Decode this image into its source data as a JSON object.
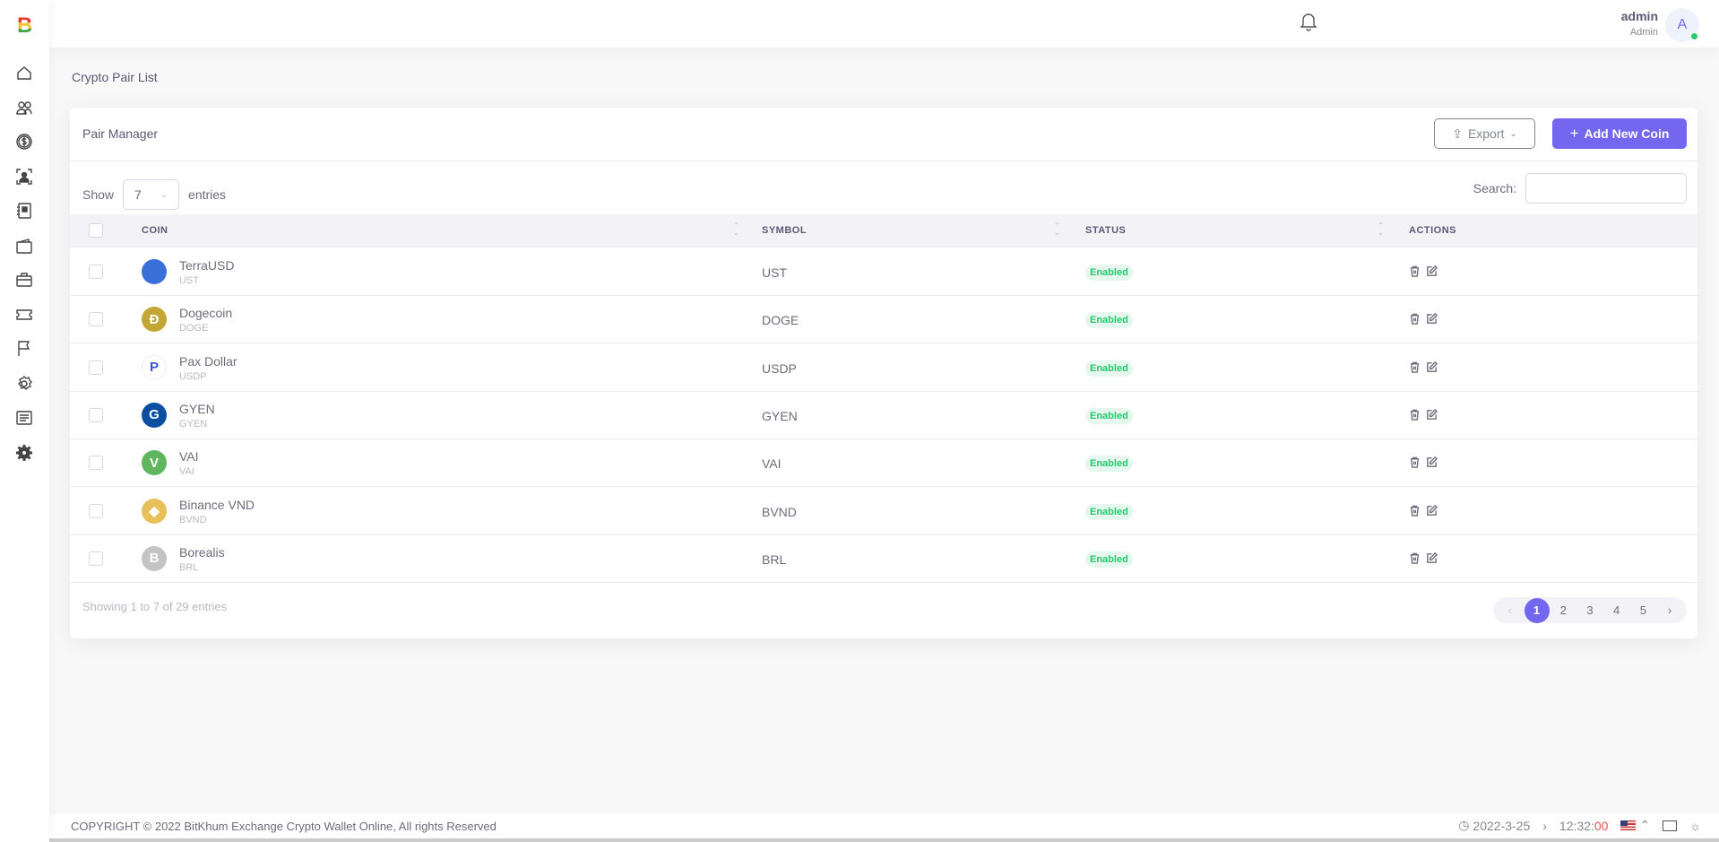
{
  "brand": {
    "logo_letter": "B"
  },
  "sidebar": {
    "items": [
      {
        "icon": "home-icon"
      },
      {
        "icon": "users-icon"
      },
      {
        "icon": "dollar-icon"
      },
      {
        "icon": "user-scan-icon"
      },
      {
        "icon": "document-icon"
      },
      {
        "icon": "wallet-icon"
      },
      {
        "icon": "briefcase-icon"
      },
      {
        "icon": "ticket-icon"
      },
      {
        "icon": "flag-icon"
      },
      {
        "icon": "settings-icon"
      },
      {
        "icon": "list-icon"
      },
      {
        "icon": "gear-filled-icon"
      }
    ]
  },
  "header": {
    "user_name": "admin",
    "user_role": "Admin",
    "avatar_letter": "A"
  },
  "breadcrumb": "Crypto Pair List",
  "card": {
    "title": "Pair Manager",
    "export_label": "Export",
    "add_label": "Add New Coin"
  },
  "table_controls": {
    "show_label": "Show",
    "entries_value": "7",
    "entries_label": "entries",
    "search_label": "Search:",
    "search_value": ""
  },
  "columns": [
    "COIN",
    "SYMBOL",
    "STATUS",
    "ACTIONS"
  ],
  "rows": [
    {
      "name": "TerraUSD",
      "sub": "UST",
      "symbol": "UST",
      "status": "Enabled",
      "icon_color": "#3a6fd8",
      "glyph": ""
    },
    {
      "name": "Dogecoin",
      "sub": "DOGE",
      "symbol": "DOGE",
      "status": "Enabled",
      "icon_color": "#c3a634",
      "glyph": "Ð"
    },
    {
      "name": "Pax Dollar",
      "sub": "USDP",
      "symbol": "USDP",
      "status": "Enabled",
      "icon_color": "#ffffff",
      "glyph": "P"
    },
    {
      "name": "GYEN",
      "sub": "GYEN",
      "symbol": "GYEN",
      "status": "Enabled",
      "icon_color": "#0b4ea2",
      "glyph": "G"
    },
    {
      "name": "VAI",
      "sub": "VAI",
      "symbol": "VAI",
      "status": "Enabled",
      "icon_color": "#5fb65f",
      "glyph": "V"
    },
    {
      "name": "Binance VND",
      "sub": "BVND",
      "symbol": "BVND",
      "status": "Enabled",
      "icon_color": "#e8c05a",
      "glyph": "◆"
    },
    {
      "name": "Borealis",
      "sub": "BRL",
      "symbol": "BRL",
      "status": "Enabled",
      "icon_color": "#c4c4c4",
      "glyph": "B"
    }
  ],
  "pagination": {
    "info": "Showing 1 to 7 of 29 entries",
    "pages": [
      "1",
      "2",
      "3",
      "4",
      "5"
    ],
    "active": "1",
    "prev": "‹",
    "next": "›"
  },
  "footer": {
    "copyright": "COPYRIGHT © 2022 BitKhum Exchange Crypto Wallet Online, All rights Reserved",
    "date": "2022-3-25",
    "time_hm": "12:32:",
    "time_s": "00"
  },
  "colors": {
    "accent": "#7367f0",
    "success": "#28c76f"
  }
}
